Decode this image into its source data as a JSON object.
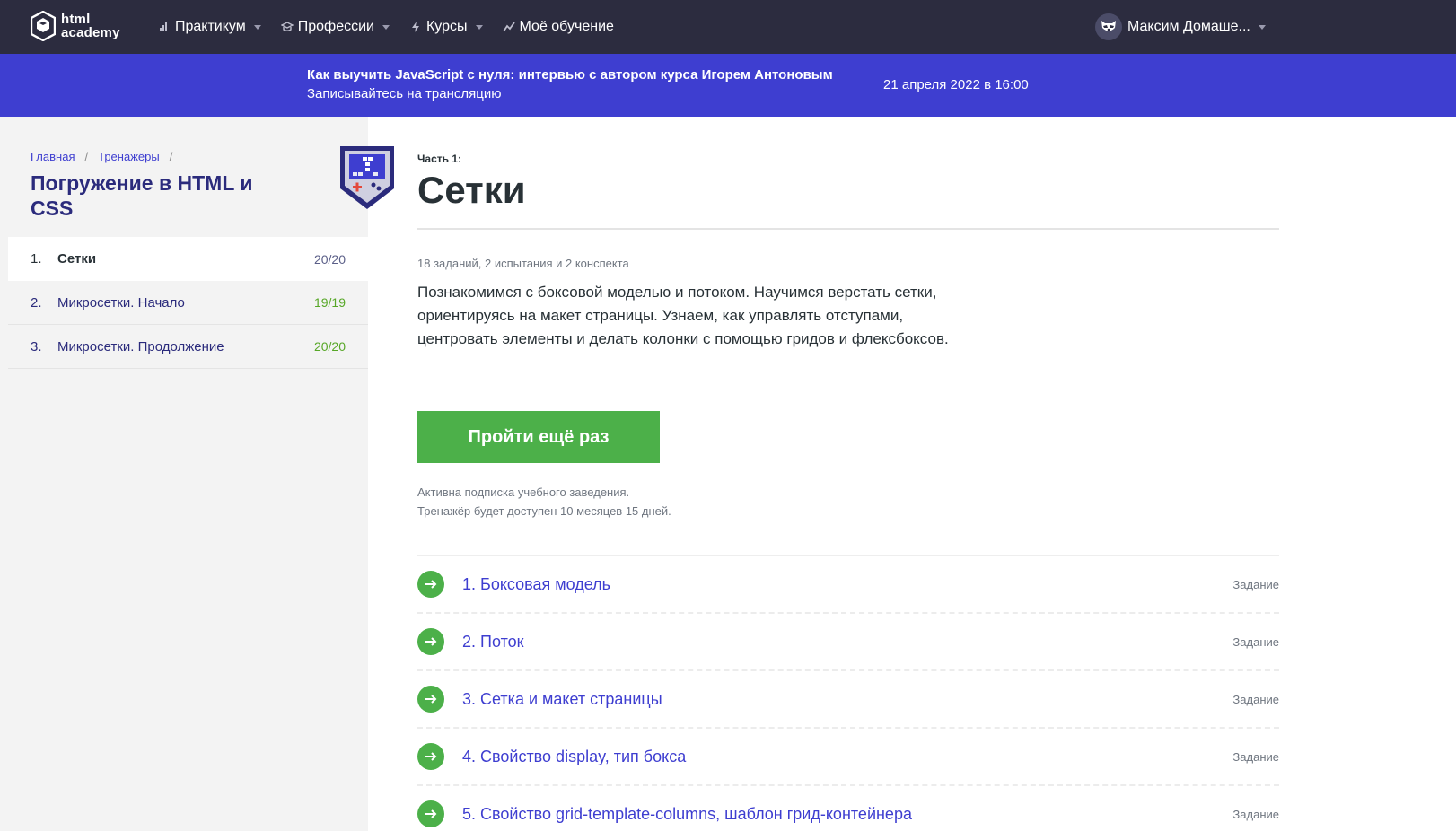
{
  "header": {
    "logo": {
      "line1": "html",
      "line2": "academy"
    },
    "nav": [
      {
        "label": "Практикум",
        "icon": "stats-icon",
        "has_dropdown": true
      },
      {
        "label": "Профессии",
        "icon": "graduation-cap-icon",
        "has_dropdown": true
      },
      {
        "label": "Курсы",
        "icon": "lightning-icon",
        "has_dropdown": true
      },
      {
        "label": "Моё обучение",
        "icon": "progress-icon",
        "has_dropdown": false
      }
    ],
    "user": {
      "name": "Максим Домаше...",
      "avatar_icon": "raccoon-avatar-icon"
    }
  },
  "promo": {
    "title": "Как выучить JavaScript с нуля: интервью с автором курса Игорем Антоновым",
    "subtitle": "Записывайтесь на трансляцию",
    "date": "21 апреля 2022 в 16:00"
  },
  "sidebar": {
    "breadcrumbs": [
      "Главная",
      "Тренажёры"
    ],
    "course_title": "Погружение в HTML и CSS",
    "badge_icon": "gameboy-badge-icon",
    "items": [
      {
        "num": "1.",
        "label": "Сетки",
        "score": "20/20",
        "active": true
      },
      {
        "num": "2.",
        "label": "Микросетки. Начало",
        "score": "19/19",
        "active": false
      },
      {
        "num": "3.",
        "label": "Микросетки. Продолжение",
        "score": "20/20",
        "active": false
      }
    ]
  },
  "main": {
    "part_label": "Часть 1:",
    "title": "Сетки",
    "meta": "18 заданий, 2 испытания и 2 конспекта",
    "description": "Познакомимся с боксовой моделью и потоком. Научимся верстать сетки, ориентируясь на макет страницы. Узнаем, как управлять отступами, центровать элементы и делать колонки с помощью гридов и флексбоксов.",
    "cta_label": "Пройти ещё раз",
    "note_line1": "Активна подписка учебного заведения.",
    "note_line2": "Тренажёр будет доступен 10 месяцев 15 дней.",
    "tasks": [
      {
        "title": "1. Боксовая модель",
        "type": "Задание"
      },
      {
        "title": "2. Поток",
        "type": "Задание"
      },
      {
        "title": "3. Сетка и макет страницы",
        "type": "Задание"
      },
      {
        "title": "4. Свойство display, тип бокса",
        "type": "Задание"
      },
      {
        "title": "5. Свойство grid-template-columns, шаблон грид-контейнера",
        "type": "Задание"
      }
    ]
  },
  "colors": {
    "header_bg": "#2c2c3f",
    "promo_bg": "#3e3ed0",
    "sidebar_bg": "#f3f3f3",
    "accent_green": "#4cb049",
    "title_navy": "#2b2b7c",
    "link_blue": "#3e3ed0"
  }
}
